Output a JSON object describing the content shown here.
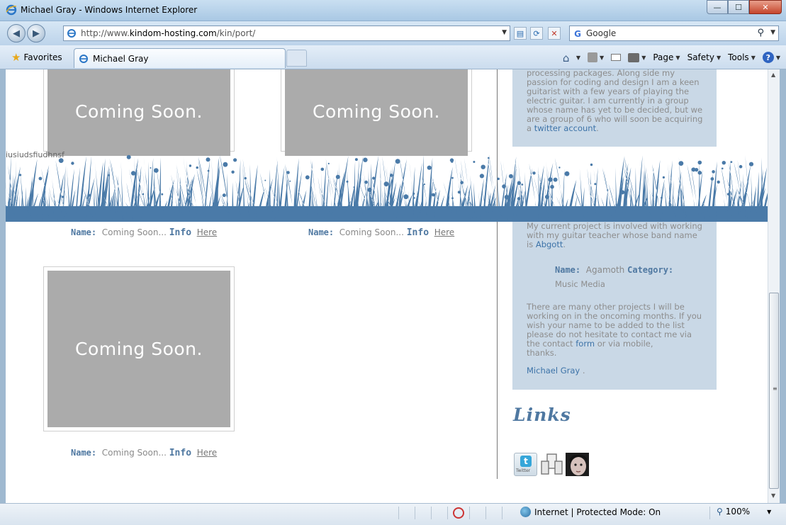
{
  "window": {
    "title": "Michael Gray - Windows Internet Explorer",
    "buttons": {
      "minimize": "—",
      "maximize": "☐",
      "close": "✕"
    }
  },
  "addressbar": {
    "url_prefix": "http://www.",
    "url_domain": "kindom-hosting.com",
    "url_path": "/kin/port/",
    "search_placeholder": "Google",
    "search_engine": "G"
  },
  "favorites": {
    "label": "Favorites"
  },
  "tab": {
    "label": "Michael Gray"
  },
  "commandbar": {
    "page": "Page",
    "safety": "Safety",
    "tools": "Tools",
    "help": "?"
  },
  "page": {
    "stray_text": "iusiudsfiudhnsf",
    "portfolio": {
      "coming_soon": "Coming Soon.",
      "items": [
        {
          "name_label": "Name:",
          "name_value": "Coming Soon...",
          "info_label": "Info",
          "link": "Here"
        },
        {
          "name_label": "Name:",
          "name_value": "Coming Soon...",
          "info_label": "Info",
          "link": "Here"
        },
        {
          "name_label": "Name:",
          "name_value": "Coming Soon...",
          "info_label": "Info",
          "link": "Here"
        }
      ]
    },
    "sidebar": {
      "about_lines": [
        "processing packages. Along side my",
        "passion for coding and design I am a keen",
        "guitarist with a few years of playing the",
        "electric guitar. I am currently in a group",
        "whose name has yet to be decided, but we",
        "are a group of 6 who will soon be acquiring"
      ],
      "about_last_prefix": "a ",
      "twitter_link": "twitter account",
      "about_last_suffix": ".",
      "project_line1": "My current project is involved with working",
      "project_line2": "with my guitar teacher whose band name",
      "project_line3_prefix": "is ",
      "band_link": "Abgott",
      "project_line3_suffix": ".",
      "project_name_label": "Name:",
      "project_name_value": "Agamoth",
      "project_category_label": "Category:",
      "project_category_value": "Music Media",
      "others_lines": [
        "There are many other projects I will be",
        "working on in the oncoming months. If you",
        "wish your name to be added to the list",
        "please do not hesitate to contact me via"
      ],
      "others_contact_prefix": "the contact ",
      "form_link": "form",
      "others_contact_suffix": " or via mobile,",
      "thanks": "thanks.",
      "signature_link": "Michael Gray",
      "signature_suffix": " .",
      "links_title": "Links",
      "twitter_icon_text": "Twitter",
      "twitter_icon_letter": "t"
    }
  },
  "statusbar": {
    "zone": "Internet | Protected Mode: On",
    "zoom": "100%"
  },
  "colors": {
    "accent_blue": "#4f78a1",
    "panel_bg": "#c9d8e6",
    "placeholder_gray": "#ababab",
    "grass_blue": "#4a7aa8"
  }
}
